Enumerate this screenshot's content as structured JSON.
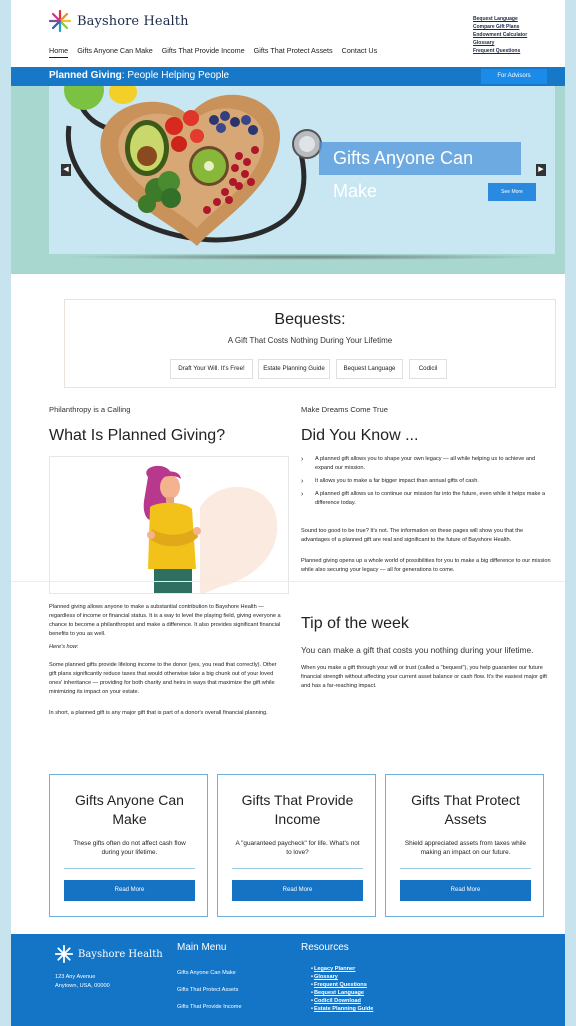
{
  "brand": {
    "name": "Bayshore Health"
  },
  "top_links": [
    "Bequest Language",
    "Compare Gift Plans",
    "Endowment Calculator",
    "Glossary",
    "Frequent Questions"
  ],
  "main_nav": [
    "Home",
    "Gifts Anyone Can Make",
    "Gifts That Provide Income",
    "Gifts That Protect Assets",
    "Contact Us"
  ],
  "blue_bar": {
    "title_bold": "Planned Giving",
    "title_rest": ": People Helping People",
    "advisors_label": "For Advisors"
  },
  "hero": {
    "caption": "Gifts Anyone Can Make",
    "button_label": "See More",
    "prev_icon": "◀",
    "next_icon": "▶"
  },
  "bequests": {
    "title": "Bequests:",
    "subtitle": "A Gift That Costs Nothing During Your Lifetime",
    "buttons": [
      "Draft Your Will. It's Free!",
      "Estate Planning Guide",
      "Bequest Language",
      "Codicil"
    ]
  },
  "left": {
    "kicker": "Philanthropy is a Calling",
    "heading": "What Is Planned Giving?",
    "p1": "Planned giving allows anyone to make a substantial contribution to Bayshore Health — regardless of income or financial status. It is a way to level the playing field, giving everyone a chance to become a philanthropist and make a difference. It also provides significant financial benefits to you as well.",
    "p2": "Here's how:",
    "p3": "Some planned gifts provide lifelong income to the donor (yes, you read that correctly). Other gift plans significantly reduce taxes that would otherwise take a big chunk out of your loved ones' inheritance — providing for both charity and heirs in ways that maximize the gift while minimizing its impact on your estate.",
    "p4": "In short, a planned gift is any major gift that is part of a donor's overall financial planning."
  },
  "right": {
    "kicker": "Make Dreams Come True",
    "heading": "Did You Know ...",
    "bullets": [
      "A planned gift allows you to shape your own legacy — all while helping us to achieve and expand our mission.",
      "It allows you to make a far bigger impact than annual gifts of cash.",
      "A planned gift allows us to continue our mission far into the future, even while it helps make a difference today."
    ],
    "p1": "Sound too good to be true? It's not. The information on these pages will show you that the advantages of a planned gift are real and significant to the future of Bayshore Health.",
    "p2": "Planned giving opens up a whole world of possibilities for you to make a big difference to our mission while also securing your legacy — all for generations to come.",
    "tip_heading": "Tip of the week",
    "tip_sub": "You can make a gift that costs you nothing during your lifetime.",
    "tip_body": "When you make a gift through your will or trust (called a \"bequest\"), you help guarantee our future financial strength without affecting your current asset balance or cash flow. It's the easiest major gift and has a far-reaching impact."
  },
  "cards": [
    {
      "title": "Gifts Anyone Can Make",
      "desc": "These gifts often do not affect cash flow during your lifetime.",
      "button": "Read More"
    },
    {
      "title": "Gifts That Provide Income",
      "desc": "A \"guaranteed paycheck\" for life. What's not to love?",
      "button": "Read More"
    },
    {
      "title": "Gifts That Protect Assets",
      "desc": "Shield appreciated assets from taxes while making an impact on our future.",
      "button": "Read More"
    }
  ],
  "footer": {
    "brand": "Bayshore Health",
    "address_line1": "123 Any Avenue",
    "address_line2": "Anytown, USA, 00000",
    "menu_heading": "Main Menu",
    "menu": [
      "Gifts Anyone Can Make",
      "Gifts That Protect Assets",
      "Gifts That Provide Income"
    ],
    "resources_heading": "Resources",
    "resources": [
      "Legacy Planner",
      "Glossary",
      "Frequent Questions",
      "Bequest Language",
      "Codicil Download",
      "Estate Planning Guide"
    ]
  },
  "colors": {
    "primary": "#1878c8",
    "footer": "#1475c7",
    "hero_bg": "#a7d7ce",
    "page_frame": "#c6e3ee"
  }
}
